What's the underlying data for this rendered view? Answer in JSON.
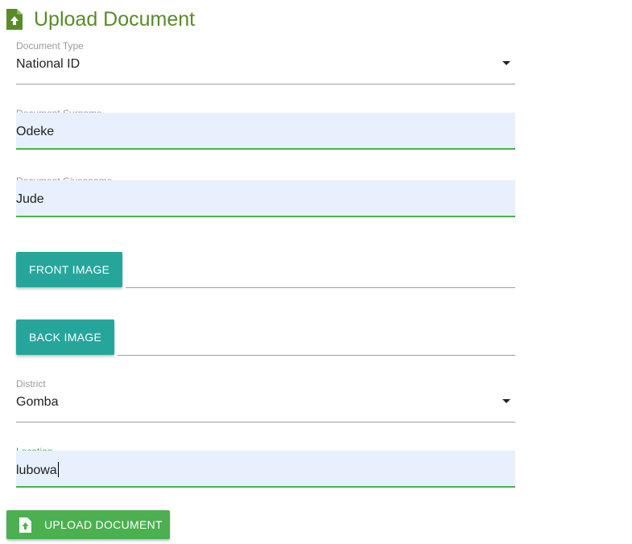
{
  "header": {
    "title": "Upload Document",
    "icon": "file-upload-icon"
  },
  "colors": {
    "brand_green": "#5a8a2a",
    "teal_button": "#26a69a",
    "upload_button": "#4caf50",
    "autofill_bg": "#e8f0fe"
  },
  "form": {
    "document_type": {
      "label": "Document Type",
      "value": "National ID"
    },
    "surname": {
      "label": "Document Surname",
      "value": "Odeke"
    },
    "givenname": {
      "label": "Document Givenname",
      "value": "Jude"
    },
    "front_image": {
      "button_label": "FRONT IMAGE"
    },
    "back_image": {
      "button_label": "BACK IMAGE"
    },
    "district": {
      "label": "District",
      "value": "Gomba"
    },
    "location": {
      "label": "Location",
      "value": "lubowa"
    }
  },
  "submit": {
    "label": "UPLOAD DOCUMENT",
    "icon": "file-upload-icon"
  }
}
